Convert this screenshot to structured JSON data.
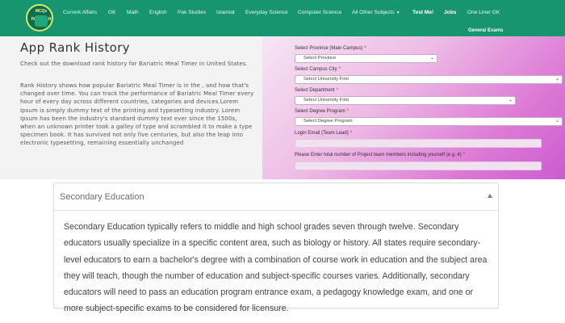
{
  "nav": {
    "logo_text": "MCQs PAKISTAN",
    "links": {
      "current_affairs": "Current Affairs",
      "gk": "GK",
      "math": "Math",
      "english": "English",
      "pak_studies": "Pak Studies",
      "islamiat": "Islamiat",
      "everyday_science": "Everyday Science",
      "computer_science": "Computer Science",
      "all_other_subjects": "All Other Subjects",
      "test_me": "Test Me!",
      "jobs": "Jobs",
      "one_liner_gk": "One Liner GK",
      "general_exams": "General Exams"
    }
  },
  "hero": {
    "title": "App Rank History",
    "intro": "Check out the download rank history for Bariatric Meal Timer in United States.",
    "body": "Rank History shows how popular Bariatric Meal Timer is in the , and how that's changed over time. You can track the performance of Bariatric Meal Timer every hour of every day across different countries, categories and devices.Lorem Ipsum is simply dummy text of the printing and typesetting industry. Lorem Ipsum has been the industry's standard dummy text ever since the 1500s, when an unknown printer took a galley of type and scrambled it to make a type specimen book. It has survived not only five centuries, but also the leap into electronic typesetting, remaining essentially unchanged"
  },
  "form": {
    "province_label": "Select Province (Main Campus)",
    "province_value": "Select Province",
    "city_label": "Select Campus City",
    "city_value": "Select University First",
    "department_label": "Select Department",
    "department_value": "Select University First",
    "degree_label": "Select Degree Program",
    "degree_value": "Select Degree Program",
    "email_label": "Login Email (Team Lead)",
    "email_value": "",
    "members_label": "Please Enter total number of Project team members including yourself (e.g. 4)",
    "members_value": "",
    "required_mark": "*"
  },
  "accordion": {
    "title": "Secondary Education",
    "body": "Secondary Education typically refers to middle and high school grades seven through twelve. Secondary educators usually specialize in a specific content area, such as biology or history. All states require secondary-level educators to earn a bachelor's degree with a combination of course work in education and the subject area they will teach, though the number of education and subject-specific courses varies. Additionally, secondary educators will need to pass an education program entrance exam, a pedagogy knowledge exam, and one or more subject-specific exams to be considered for licensure."
  },
  "colors": {
    "nav_bg": "#16956f",
    "hero_left_bg": "#f3f3f3",
    "form_gradient_end": "#cc5bd0",
    "required": "#d21f3c"
  }
}
